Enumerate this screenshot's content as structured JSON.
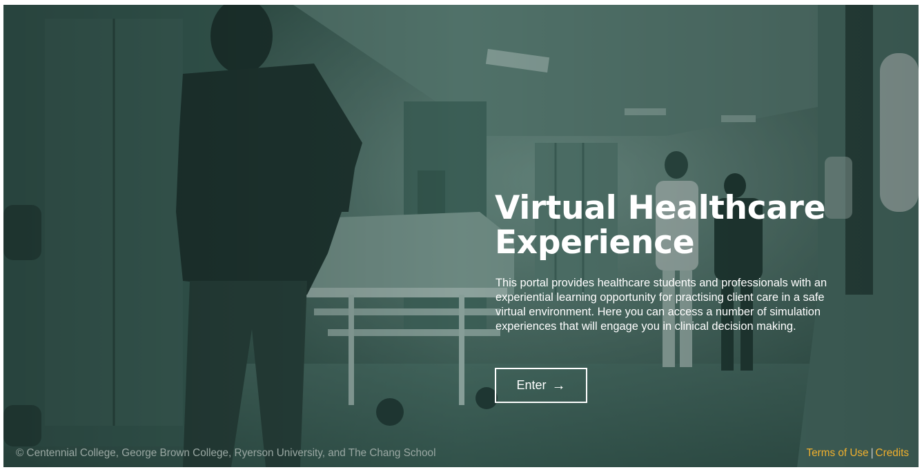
{
  "hero": {
    "title": "Virtual Healthcare Experience",
    "description": "This portal provides healthcare students and professionals with an experiential learning opportunity for practising client care in a safe virtual environment. Here you can access a number of simulation experiences that will engage you in clinical decision making.",
    "enter_label": "Enter",
    "enter_icon": "arrow-right-icon"
  },
  "footer": {
    "copyright": "© Centennial College, George Brown College, Ryerson University, and The Chang School",
    "terms_label": "Terms of Use",
    "separator": "|",
    "credits_label": "Credits"
  },
  "colors": {
    "overlay_tint": "#2f4d45",
    "link_accent": "#f2b12d",
    "text": "#ffffff"
  }
}
